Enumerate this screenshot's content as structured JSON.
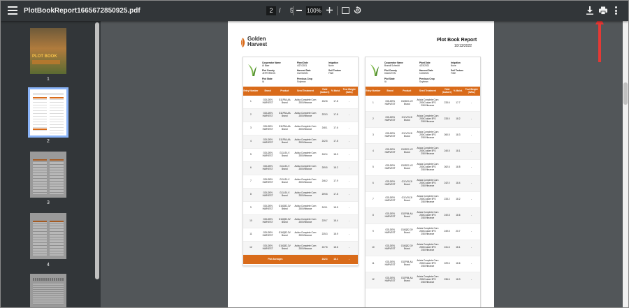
{
  "toolbar": {
    "filename": "PlotBookReport1665672850925.pdf",
    "current_page": "2",
    "page_separator": "/",
    "total_pages": "5",
    "zoom": "100%"
  },
  "sidebar": {
    "thumbnails": [
      {
        "label": "1",
        "cover_text": "PLOT BOOK"
      },
      {
        "label": "2"
      },
      {
        "label": "3"
      },
      {
        "label": "4"
      },
      {
        "label": ""
      }
    ]
  },
  "document": {
    "logo_line1": "Golden",
    "logo_line2": "Harvest",
    "report_title": "Plot Book Report",
    "report_date": "10/13/2022",
    "left_card": {
      "meta": [
        {
          "label": "Cooperator Name",
          "value": "Al Baer"
        },
        {
          "label": "Plant Date",
          "value": "4/27/2021"
        },
        {
          "label": "Irrigation",
          "value": "None"
        },
        {
          "label": "Plot County",
          "value": "JEFFERSON"
        },
        {
          "label": "Harvest Date",
          "value": "10/19/2021"
        },
        {
          "label": "Soil Texture",
          "value": "FINE"
        },
        {
          "label": "Plot State",
          "value": "IA"
        },
        {
          "label": "Previous Crop",
          "value": "Soybean"
        }
      ],
      "columns": [
        "Entry Number",
        "Brand",
        "Product",
        "Seed Treatment",
        "Yield (bu/acre)",
        "% Moist.",
        "Test Weight (lb/bu)"
      ],
      "rows": [
        [
          "1",
          "GOLDEN HARVEST",
          "G11P84-AA Brand",
          "Avicta Complete Corn 250/Vibrance",
          "232.8",
          "17.8",
          "-"
        ],
        [
          "2",
          "GOLDEN HARVEST",
          "G11P84-AA Brand",
          "Avicta Complete Corn 250/Vibrance",
          "233.3",
          "17.8",
          "-"
        ],
        [
          "3",
          "GOLDEN HARVEST",
          "G11P84-AA Brand",
          "Avicta Complete Corn 250/Vibrance",
          "248.1",
          "17.6",
          "-"
        ],
        [
          "4",
          "GOLDEN HARVEST",
          "G11P84-AA Brand",
          "Avicta Complete Corn 250/Vibrance",
          "242.5",
          "17.8",
          "-"
        ],
        [
          "5",
          "GOLDEN HARVEST",
          "G11L91-V Brand",
          "Avicta Complete Corn 250/Vibrance",
          "242.4",
          "18.3",
          "-"
        ],
        [
          "6",
          "GOLDEN HARVEST",
          "G11L91-V Brand",
          "Avicta Complete Corn 250/Vibrance",
          "209.5",
          "18.2",
          "-"
        ],
        [
          "7",
          "GOLDEN HARVEST",
          "G11L91-V Brand",
          "Avicta Complete Corn 250/Vibrance",
          "246.2",
          "17.9",
          "-"
        ],
        [
          "8",
          "GOLDEN HARVEST",
          "G11L91-V Brand",
          "Avicta Complete Corn 250/Vibrance",
          "209.8",
          "17.8",
          "-"
        ],
        [
          "9",
          "GOLDEN HARVEST",
          "G16Q82-3V Brand",
          "Avicta Complete Corn 250/Vibrance",
          "243.1",
          "18.5",
          "-"
        ],
        [
          "10",
          "GOLDEN HARVEST",
          "G16Q82-3V Brand",
          "Avicta Complete Corn 250/Vibrance",
          "229.7",
          "18.4",
          "-"
        ],
        [
          "11",
          "GOLDEN HARVEST",
          "G16Q82-3V Brand",
          "Avicta Complete Corn 250/Vibrance",
          "225.3",
          "18.9",
          "-"
        ],
        [
          "12",
          "GOLDEN HARVEST",
          "G16Q82-3V Brand",
          "Avicta Complete Corn 250/Vibrance",
          "227.8",
          "18.6",
          "-"
        ]
      ],
      "average": {
        "label": "Plot Averages",
        "yield": "242.3",
        "moist": "18.1",
        "tw": "-"
      }
    },
    "right_card": {
      "meta": [
        {
          "label": "Cooperator Name",
          "value": "Brandi Schmidt"
        },
        {
          "label": "Plant Date",
          "value": "4/23/2021"
        },
        {
          "label": "Irrigation",
          "value": "None"
        },
        {
          "label": "Plot County",
          "value": "HAMILTON"
        },
        {
          "label": "Harvest Date",
          "value": "11/8/2021"
        },
        {
          "label": "Soil Texture",
          "value": "FINE"
        },
        {
          "label": "Plot State",
          "value": "IA"
        },
        {
          "label": "Previous Crop",
          "value": "Soybean"
        }
      ],
      "columns": [
        "Entry Number",
        "Brand",
        "Product",
        "Seed Treatment",
        "Yield (bu/acre)",
        "% Moist.",
        "Test Weight (lb/bu)"
      ],
      "rows": [
        [
          "1",
          "GOLDEN HARVEST",
          "G10D21-V2 Brand",
          "Avicta Complete Corn 250/Cruiser 5FS 250/Vibrance",
          "233.6",
          "17.7",
          "-"
        ],
        [
          "2",
          "GOLDEN HARVEST",
          "G11V76-3I Brand",
          "Avicta Complete Corn 250/Cruiser 5FS 250/Vibrance",
          "233.0",
          "18.2",
          "-"
        ],
        [
          "3",
          "GOLDEN HARVEST",
          "G11V76-3I Brand",
          "Avicta Complete Corn 250/Cruiser 5FS 250/Vibrance",
          "260.5",
          "18.3",
          "-"
        ],
        [
          "4",
          "GOLDEN HARVEST",
          "G10D21-V2 Brand",
          "Avicta Complete Corn 250/Cruiser 5FS 250/Vibrance",
          "240.5",
          "18.1",
          "-"
        ],
        [
          "5",
          "GOLDEN HARVEST",
          "G10D21-V2 Brand",
          "Avicta Complete Corn 250/Cruiser 5FS 250/Vibrance",
          "262.6",
          "18.5",
          "-"
        ],
        [
          "6",
          "GOLDEN HARVEST",
          "G11V76-3I Brand",
          "Avicta Complete Corn 250/Cruiser 5FS 250/Vibrance",
          "242.0",
          "18.4",
          "-"
        ],
        [
          "7",
          "GOLDEN HARVEST",
          "G11V76-3I Brand",
          "Avicta Complete Corn 250/Cruiser 5FS 250/Vibrance",
          "233.2",
          "18.2",
          "-"
        ],
        [
          "8",
          "GOLDEN HARVEST",
          "G11P84-AA Brand",
          "Avicta Complete Corn 250/Cruiser 5FS 250/Vibrance",
          "240.8",
          "18.6",
          "-"
        ],
        [
          "9",
          "GOLDEN HARVEST",
          "G16Q82-3V Brand",
          "Avicta Complete Corn 250/Cruiser 5FS 250/Vibrance",
          "249.5",
          "20.7",
          "-"
        ],
        [
          "10",
          "GOLDEN HARVEST",
          "G16Q82-3V Brand",
          "Avicta Complete Corn 250/Cruiser 5FS 250/Vibrance",
          "241.6",
          "18.1",
          "-"
        ],
        [
          "11",
          "GOLDEN HARVEST",
          "G11P84-AA Brand",
          "Avicta Complete Corn 250/Cruiser 5FS 250/Vibrance",
          "229.6",
          "18.6",
          "-"
        ],
        [
          "12",
          "GOLDEN HARVEST",
          "G11P84-AA Brand",
          "Avicta Complete Corn 250/Cruiser 5FS 250/Vibrance",
          "236.6",
          "18.3",
          "-"
        ]
      ]
    }
  },
  "colors": {
    "toolbar_bg": "#323639",
    "viewer_bg": "#525659",
    "table_header": "#d96b1a",
    "thumb_selected": "#8ab4f8",
    "annotation_arrow": "#e53935"
  }
}
